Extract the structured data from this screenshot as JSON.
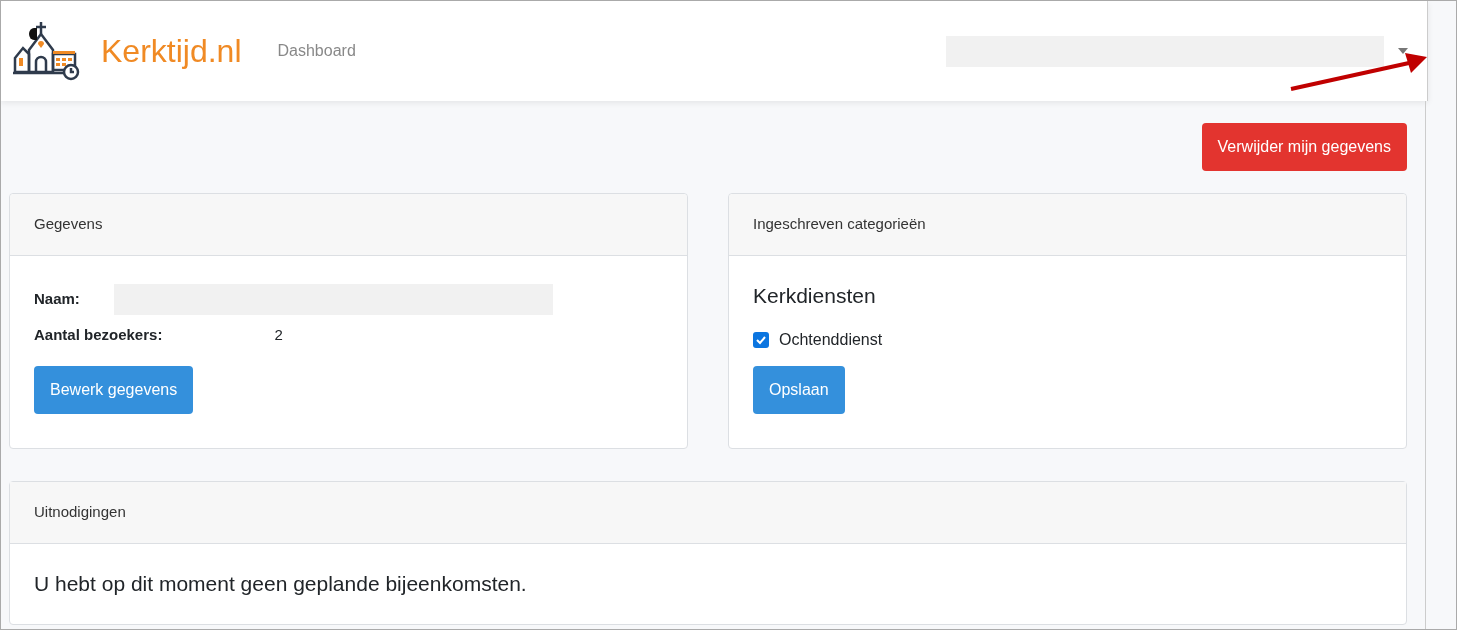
{
  "header": {
    "brand": "Kerktijd.nl",
    "nav": [
      {
        "label": "Dashboard",
        "selected": false
      }
    ]
  },
  "delete_button": "Verwijder mijn gegevens",
  "details_card": {
    "title": "Gegevens",
    "fields": [
      {
        "label": "Naam:",
        "redacted": true
      },
      {
        "label": "Aantal bezoekers:",
        "value": "2",
        "redacted": false
      }
    ],
    "button": "Bewerk gegevens"
  },
  "categories_card": {
    "title": "Ingeschreven categorieën",
    "groups": [
      {
        "heading": "Kerkdiensten",
        "options": [
          {
            "label": "Ochtenddienst",
            "checked": true
          }
        ]
      }
    ],
    "button": "Opslaan"
  },
  "invitations_card": {
    "title": "Uitnodigingen",
    "message": "U hebt op dit moment geen geplande bijeenkomsten."
  }
}
